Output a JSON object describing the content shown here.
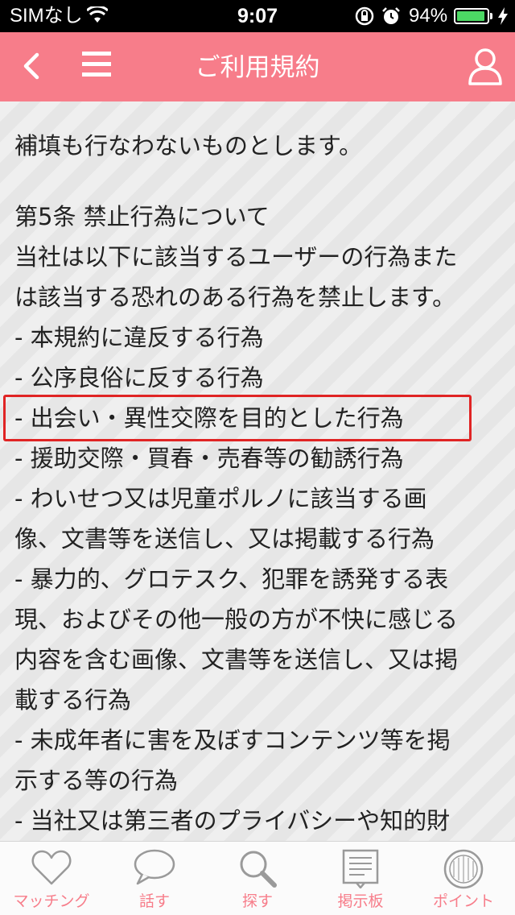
{
  "status_bar": {
    "carrier": "SIMなし",
    "time": "9:07",
    "battery_percent": "94%",
    "battery_level": 0.94,
    "battery_color": "#4cd964"
  },
  "nav": {
    "title": "ご利用規約",
    "back_icon": "chevron-left-icon",
    "menu_icon": "hamburger-icon",
    "user_icon": "user-icon",
    "bg_color": "#f77d8a"
  },
  "content": {
    "lines": [
      "補填も行なわないものとします。",
      "",
      "第5条 禁止行為について",
      "当社は以下に該当するユーザーの行為また",
      "は該当する恐れのある行為を禁止します。",
      "- 本規約に違反する行為",
      "- 公序良俗に反する行為",
      "- 出会い・異性交際を目的とした行為",
      "- 援助交際・買春・売春等の勧誘行為",
      "- わいせつ又は児童ポルノに該当する画",
      "像、文書等を送信し、又は掲載する行為",
      "- 暴力的、グロテスク、犯罪を誘発する表",
      "現、およびその他一般の方が不快に感じる",
      "内容を含む画像、文書等を送信し、又は掲",
      "載する行為",
      "- 未成年者に害を及ぼすコンテンツ等を掲",
      "示する等の行為",
      "- 当社又は第三者のプライバシーや知的財"
    ],
    "highlight_color": "#e02424"
  },
  "tabs": [
    {
      "label": "マッチング",
      "icon": "heart-icon"
    },
    {
      "label": "話す",
      "icon": "speech-bubble-icon"
    },
    {
      "label": "探す",
      "icon": "search-icon"
    },
    {
      "label": "掲示板",
      "icon": "bulletin-board-icon"
    },
    {
      "label": "ポイント",
      "icon": "coin-icon"
    }
  ],
  "tab_label_color": "#f77d8a"
}
